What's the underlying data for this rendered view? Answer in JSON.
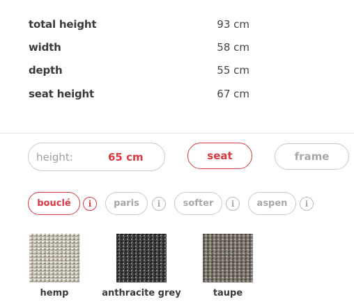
{
  "specs": [
    {
      "label": "total height",
      "value": "93 cm"
    },
    {
      "label": "width",
      "value": "58 cm"
    },
    {
      "label": "depth",
      "value": "55 cm"
    },
    {
      "label": "seat height",
      "value": "67 cm"
    }
  ],
  "controls": {
    "height_label": "height:",
    "height_value": "65 cm",
    "seat_label": "seat",
    "frame_label": "frame"
  },
  "materials": [
    {
      "label": "bouclé",
      "active": true
    },
    {
      "label": "paris",
      "active": false
    },
    {
      "label": "softer",
      "active": false
    },
    {
      "label": "aspen",
      "active": false
    }
  ],
  "info_icon": "i",
  "swatches": [
    {
      "label": "hemp",
      "color": "#cbc6ba"
    },
    {
      "label": "anthracite grey",
      "color": "#3d3d3f"
    },
    {
      "label": "taupe",
      "color": "#77716a"
    }
  ],
  "colors": {
    "accent": "#d8383f",
    "border": "#c9c9c9",
    "text": "#3a3a3a",
    "muted": "#a8a8a8"
  }
}
